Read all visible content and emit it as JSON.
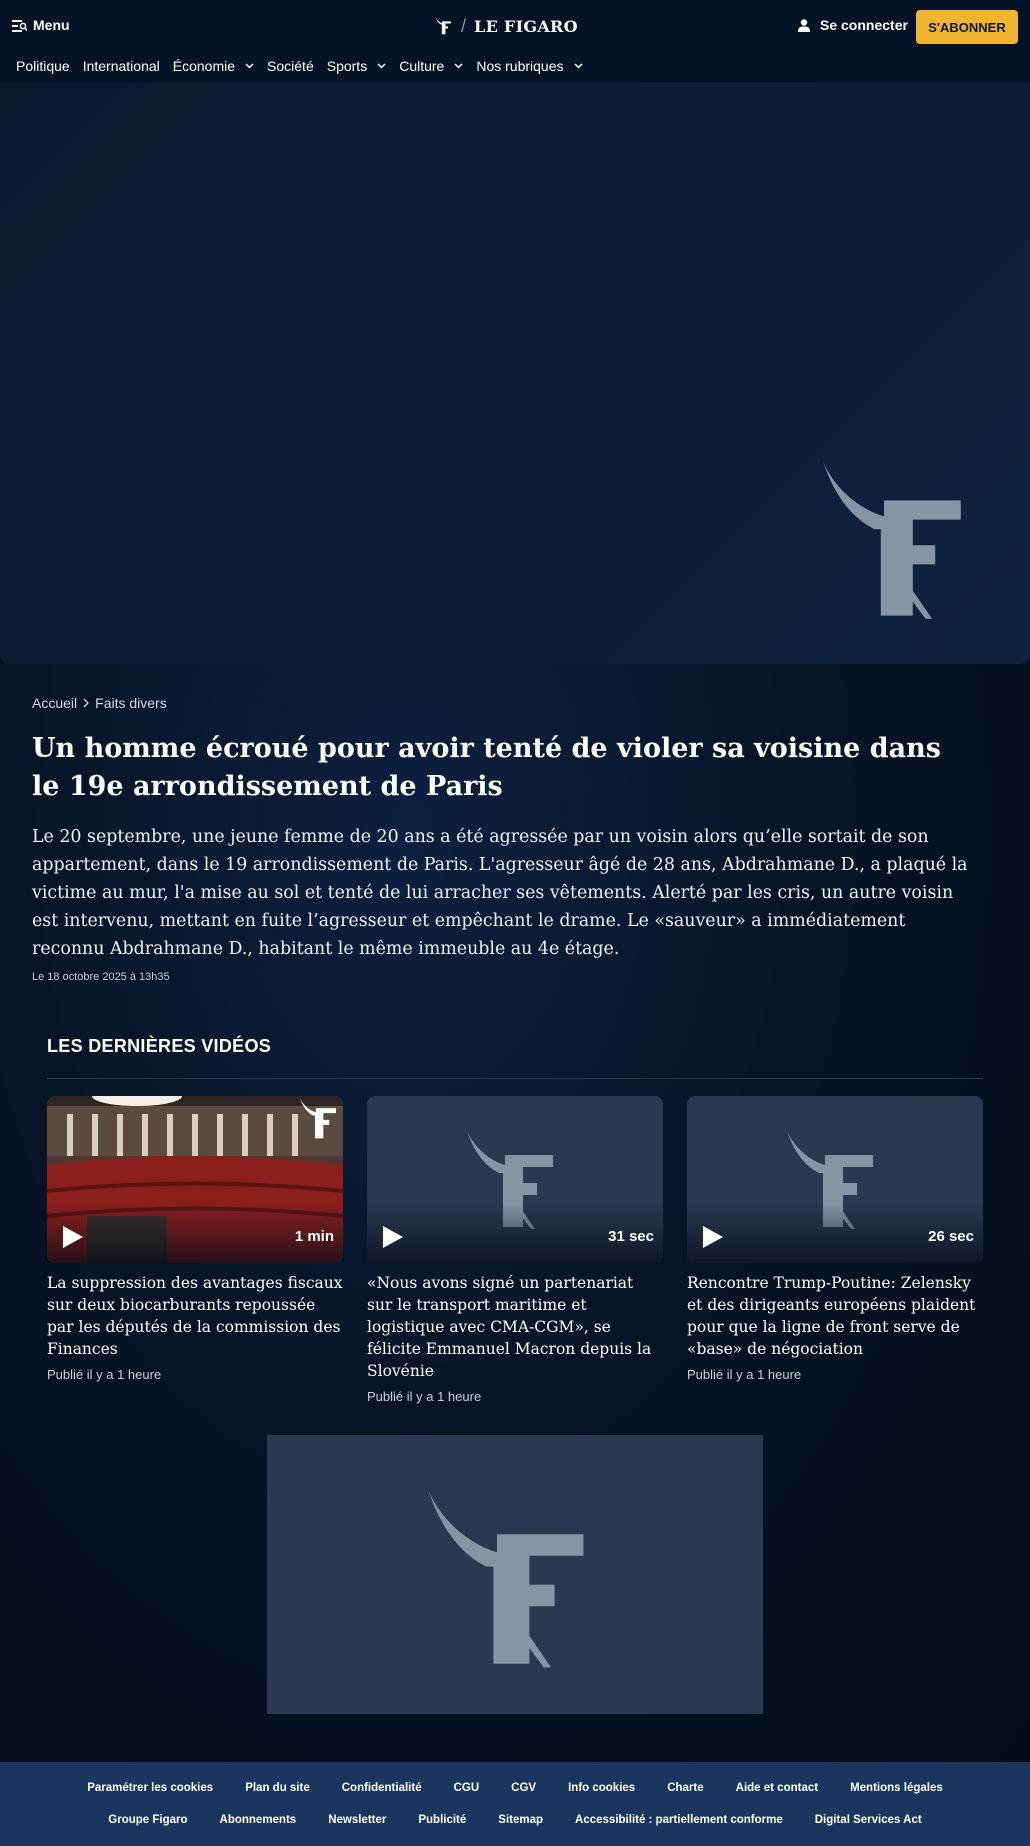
{
  "header": {
    "menu_label": "Menu",
    "logo_text": "LE FIGARO",
    "login_label": "Se connecter",
    "subscribe_label": "S'ABONNER"
  },
  "nav": {
    "items": [
      {
        "label": "Politique",
        "dropdown": false
      },
      {
        "label": "International",
        "dropdown": false
      },
      {
        "label": "Économie",
        "dropdown": true
      },
      {
        "label": "Société",
        "dropdown": false
      },
      {
        "label": "Sports",
        "dropdown": true
      },
      {
        "label": "Culture",
        "dropdown": true
      },
      {
        "label": "Nos rubriques",
        "dropdown": true
      }
    ]
  },
  "breadcrumb": {
    "home": "Accueil",
    "section": "Faits divers"
  },
  "article": {
    "title": "Un homme écroué pour avoir tenté de violer sa voisine dans le 19e arrondissement de Paris",
    "lede": "Le 20 septembre, une jeune femme de 20 ans a été agressée par un voisin alors qu’elle sortait de son appartement, dans le 19 arrondissement de Paris. L'agresseur âgé de 28 ans, Abdrahmane D., a plaqué la victime au mur, l'a mise au sol et tenté de lui arracher ses vêtements. Alerté par les cris, un autre voisin est intervenu, mettant en fuite l’agresseur et empêchant le drame. Le «sauveur» a immédiatement reconnu Abdrahmane D., habitant le même immeuble au 4e étage.",
    "date": "Le 18 octobre 2025 à 13h35"
  },
  "videos": {
    "heading": "LES DERNIÈRES VIDÉOS",
    "items": [
      {
        "title": "La suppression des avantages fiscaux sur deux biocarburants repoussée par les députés de la commission des Finances",
        "duration": "1 min",
        "published": "Publié il y a 1 heure"
      },
      {
        "title": "«Nous avons signé un partenariat sur le transport maritime et logistique avec CMA-CGM», se félicite Emmanuel Macron depuis la Slovénie",
        "duration": "31 sec",
        "published": "Publié il y a 1 heure"
      },
      {
        "title": "Rencontre Trump-Poutine: Zelensky et des dirigeants européens plaident pour que la ligne de front serve de «base» de négociation",
        "duration": "26 sec",
        "published": "Publié il y a 1 heure"
      }
    ]
  },
  "footer": {
    "row1": [
      "Paramétrer les cookies",
      "Plan du site",
      "Confidentialité",
      "CGU",
      "CGV",
      "Info cookies",
      "Charte",
      "Aide et contact",
      "Mentions légales"
    ],
    "row2": [
      "Groupe Figaro",
      "Abonnements",
      "Newsletter",
      "Publicité",
      "Sitemap",
      "Accessibilité : partiellement conforme",
      "Digital Services Act"
    ]
  },
  "colors": {
    "background": "#050f1e",
    "accent": "#f1b42f",
    "footer": "#1a365f",
    "placeholder": "#2b3852",
    "logo_gray": "#8893a4"
  }
}
